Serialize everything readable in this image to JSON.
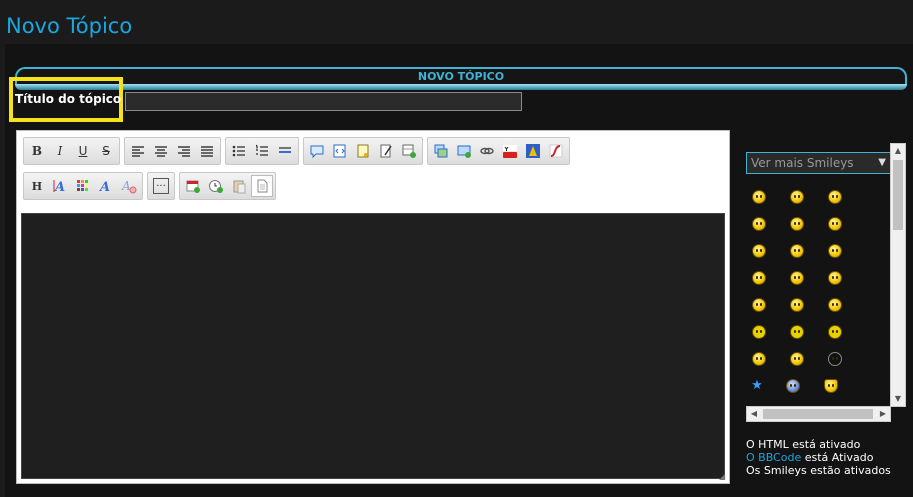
{
  "page": {
    "title": "Novo Tópico"
  },
  "form": {
    "header": "NOVO TÓPICO",
    "title_label": "Título do tópico",
    "title_value": ""
  },
  "toolbar": {
    "bold": "B",
    "italic": "I",
    "underline": "U",
    "strike": "S",
    "heading": "H",
    "more": "···"
  },
  "smileys": {
    "select_label": "Ver mais Smileys",
    "select_arrow": "▼"
  },
  "status": {
    "html": "O HTML está ativado",
    "bbcode_link": "O BBCode",
    "bbcode_rest": " está Ativado",
    "smileys": "Os Smileys estão ativados"
  },
  "colors": {
    "accent": "#1aa7e0",
    "highlight": "#f5e21a",
    "header_border": "#3fb3d6"
  }
}
